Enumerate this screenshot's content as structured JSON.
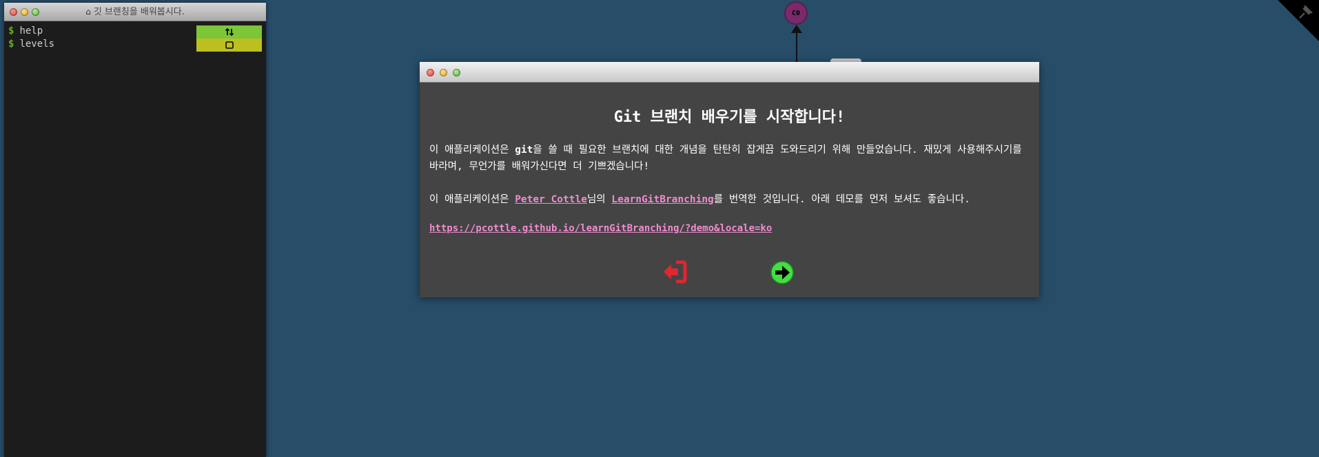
{
  "terminal": {
    "title": "깃 브랜칭을 배워봅시다.",
    "lines": [
      {
        "prompt": "$",
        "command": "help"
      },
      {
        "prompt": "$",
        "command": "levels"
      }
    ]
  },
  "graph": {
    "commit_label": "C0",
    "commit_color": "#7a2a6a"
  },
  "modal": {
    "title": "Git 브랜치 배우기를 시작합니다!",
    "p1_before": "이 애플리케이션은 ",
    "p1_bold": "git",
    "p1_after": "을 쓸 때 필요한 브랜치에 대한 개념을 탄탄히 잡게끔 도와드리기 위해 만들었습니다. 재밌게 사용해주시기를 바라며, 무언가를 배워가신다면 더 기쁘겠습니다!",
    "p2_before": "이 애플리케이션은 ",
    "p2_link1": "Peter Cottle",
    "p2_middle": "님의 ",
    "p2_link2": "LearnGitBranching",
    "p2_after": "를 번역한 것입니다. 아래 데모를 먼저 보셔도 좋습니다.",
    "demo_url": "https://pcottle.github.io/learnGitBranching/?demo&locale=ko",
    "quit_icon": "sign-out-icon",
    "next_icon": "arrow-right-circle-icon"
  },
  "colors": {
    "background": "#274d69",
    "terminal_bg": "#1c1c1c",
    "prompt": "#5fb51a",
    "link": "#f08cd0",
    "quit": "#e0262f",
    "next": "#44dd44",
    "green_btn": "#7cc637",
    "yellow_btn": "#bcbf20"
  }
}
